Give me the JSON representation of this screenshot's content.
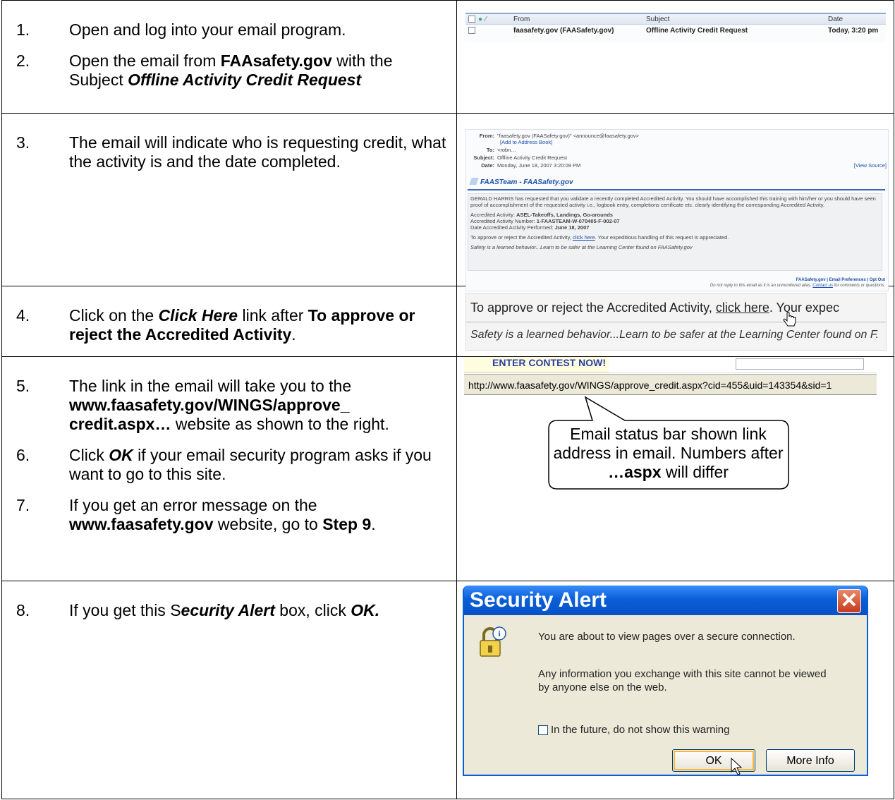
{
  "rows": [
    {
      "steps": [
        {
          "num": "1.",
          "parts": [
            {
              "t": "Open and log into your email program.",
              "s": ""
            }
          ]
        },
        {
          "num": "2.",
          "parts": [
            {
              "t": "Open the email from ",
              "s": ""
            },
            {
              "t": "FAAsafety.gov",
              "s": "b"
            },
            {
              "t": " with the Subject ",
              "s": ""
            },
            {
              "t": "Offline Activity Credit Request",
              "s": "bi"
            }
          ]
        }
      ]
    },
    {
      "steps": [
        {
          "num": "3.",
          "parts": [
            {
              "t": "The email will indicate who is requesting credit, what the activity is and the date completed.",
              "s": ""
            }
          ]
        }
      ]
    },
    {
      "steps": [
        {
          "num": "4.",
          "parts": [
            {
              "t": "Click on the ",
              "s": ""
            },
            {
              "t": "Click Here",
              "s": "bi"
            },
            {
              "t": " link after ",
              "s": ""
            },
            {
              "t": "To approve or reject the Accredited Activity",
              "s": "b"
            },
            {
              "t": ".",
              "s": ""
            }
          ]
        }
      ]
    },
    {
      "steps": [
        {
          "num": "5.",
          "parts": [
            {
              "t": "The link in the email will take you to the ",
              "s": ""
            },
            {
              "t": "www.faasafety.gov/WINGS/approve_ credit.aspx…",
              "s": "b"
            },
            {
              "t": " website as shown to the right.",
              "s": ""
            }
          ]
        },
        {
          "num": "6.",
          "parts": [
            {
              "t": "Click ",
              "s": ""
            },
            {
              "t": "OK",
              "s": "bi"
            },
            {
              "t": " if your email security program asks if you want to go to this site.",
              "s": ""
            }
          ]
        },
        {
          "num": "7.",
          "parts": [
            {
              "t": "If you get an error message on the ",
              "s": ""
            },
            {
              "t": "www.faasafety.gov",
              "s": "b"
            },
            {
              "t": " website, go to ",
              "s": ""
            },
            {
              "t": "Step 9",
              "s": "b"
            },
            {
              "t": ".",
              "s": ""
            }
          ]
        }
      ]
    },
    {
      "steps": [
        {
          "num": "8.",
          "parts": [
            {
              "t": "If you get this S",
              "s": ""
            },
            {
              "t": "ecurity Alert",
              "s": "bi"
            },
            {
              "t": " box, click ",
              "s": ""
            },
            {
              "t": "OK.",
              "s": "bi"
            }
          ]
        }
      ]
    }
  ],
  "inbox": {
    "col_from": "From",
    "col_subject": "Subject",
    "col_date": "Date",
    "from": "faasafety.gov (FAASafety.gov)",
    "subject": "Offline Activity Credit Request",
    "date": "Today, 3:20 pm"
  },
  "email": {
    "from_label": "From:",
    "from_value": "\"faasafety.gov (FAASafety.gov)\" <announce@faasafety.gov>",
    "add_book": "[Add to Address Book]",
    "to_label": "To:",
    "to_value": "<robn…",
    "subject_label": "Subject:",
    "subject_value": "Offline Activity Credit Request",
    "date_label": "Date:",
    "date_value": "Monday, June 18, 2007 3:20:09 PM",
    "view_source": "[View Source]",
    "brand": "FAASTeam - FAASafety.gov",
    "p1": "GERALD HARRIS has requested that you validate a recently completed Accredited Activity. You should have accomplished this training with him/her or you should have seen proof of accomplishment of the requested activity i.e., logbook entry, completions certificate etc. clearly identifying the corresponding Accredited Activity.",
    "a_line1_label": "Accredited Activity: ",
    "a_line1_value": "ASEL-Takeoffs, Landings, Go-arounds",
    "a_line2_label": "Accredited Activity Number: ",
    "a_line2_value": "1-FAASTEAM-W-070405-F-002-07",
    "a_line3_label": "Date Accredited Activity Performed: ",
    "a_line3_value": "June 18, 2007",
    "p3_a": "To approve or reject the Accredited Activity, ",
    "p3_link": "click here",
    "p3_b": ". Your expeditious handling of this request is appreciated.",
    "p4": "Safety is a learned behavior...Learn to be safer at the Learning Center found on FAASafety.gov",
    "foot1": "FAASafety.gov | Email Preferences | Opt Out",
    "foot2_a": "Do not reply to this email as it is an unmonitored alias. ",
    "foot2_link": "Contact us",
    "foot2_b": " for comments or questions."
  },
  "zoom": {
    "line1_a": "To approve or reject the Accredited Activity, ",
    "line1_link": "click here",
    "line1_b": ". Your expec",
    "line2": "Safety is a learned behavior...Learn to be safer at the Learning Center found on F."
  },
  "statusbar": {
    "contest": "ENTER CONTEST NOW!",
    "url": "http://www.faasafety.gov/WINGS/approve_credit.aspx?cid=455&uid=143354&sid=1",
    "callout_a": "Email status bar shown link address in email.  Numbers after ",
    "callout_bold": "…aspx",
    "callout_b": " will differ"
  },
  "dialog": {
    "title": "Security Alert",
    "close": "✕",
    "line1": "You are about to view pages over a secure connection.",
    "line2": "Any information you exchange with this site cannot be viewed by anyone else on the web.",
    "checkbox": "In the future, do not show this warning",
    "ok": "OK",
    "more_info": "More Info"
  }
}
